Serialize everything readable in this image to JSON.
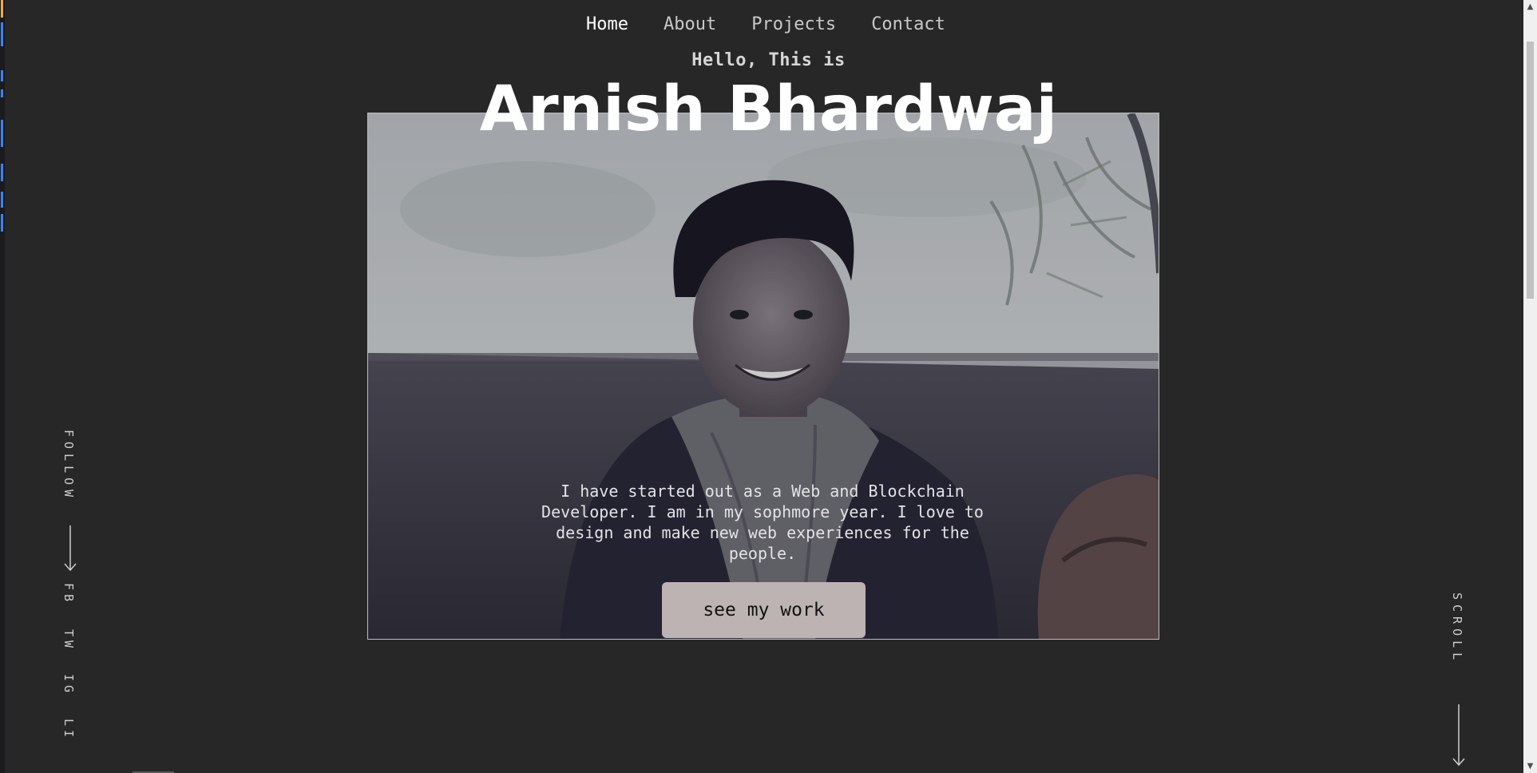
{
  "nav": {
    "items": [
      {
        "label": "Home",
        "active": true
      },
      {
        "label": "About",
        "active": false
      },
      {
        "label": "Projects",
        "active": false
      },
      {
        "label": "Contact",
        "active": false
      }
    ]
  },
  "hero": {
    "greeting": "Hello, This is",
    "name": "Arnish Bhardwaj",
    "bio": "I have started out as a Web and Blockchain Developer. I am in my sophmore year. I love to design and make new web experiences for the people.",
    "cta_label": "see my work"
  },
  "social": {
    "follow_label": "FOLLOW",
    "links": [
      "FB",
      "TW",
      "IG",
      "LI"
    ]
  },
  "scroll_label": "SCROLL",
  "colors": {
    "background": "#272727",
    "button": "#bdb3b3",
    "text": "#ffffff"
  }
}
